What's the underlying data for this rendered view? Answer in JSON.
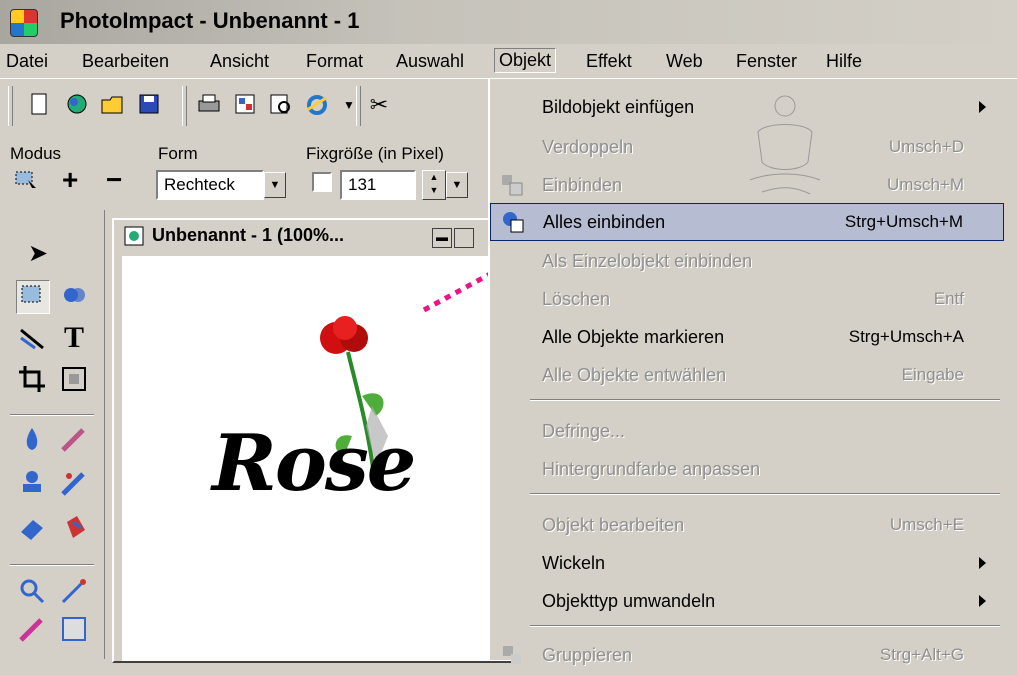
{
  "app": {
    "title": "PhotoImpact - Unbenannt - 1"
  },
  "menubar": {
    "items": [
      "Datei",
      "Bearbeiten",
      "Ansicht",
      "Format",
      "Auswahl",
      "Objekt",
      "Effekt",
      "Web",
      "Fenster",
      "Hilfe"
    ],
    "active": "Objekt"
  },
  "attrbar": {
    "modus_label": "Modus",
    "form_label": "Form",
    "fixsize_label": "Fixgröße (in Pixel)",
    "form_value": "Rechteck",
    "size_value": "131"
  },
  "document": {
    "title": "Unbenannt - 1 (100%...",
    "canvas_text": "Rose"
  },
  "menu": {
    "items": [
      {
        "label": "Bildobjekt einfügen",
        "shortcut": "",
        "disabled": false,
        "submenu": true
      },
      {
        "label": "Verdoppeln",
        "shortcut": "Umsch+D",
        "disabled": true,
        "submenu": false
      },
      {
        "label": "Einbinden",
        "shortcut": "Umsch+M",
        "disabled": true,
        "submenu": false
      },
      {
        "label": "Alles einbinden",
        "shortcut": "Strg+Umsch+M",
        "disabled": false,
        "submenu": false,
        "highlighted": true
      },
      {
        "label": "Als Einzelobjekt einbinden",
        "shortcut": "",
        "disabled": true,
        "submenu": false
      },
      {
        "label": "Löschen",
        "shortcut": "Entf",
        "disabled": true,
        "submenu": false
      },
      {
        "label": "Alle Objekte markieren",
        "shortcut": "Strg+Umsch+A",
        "disabled": false,
        "submenu": false
      },
      {
        "label": "Alle Objekte entwählen",
        "shortcut": "Eingabe",
        "disabled": true,
        "submenu": false
      },
      {
        "label": "Defringe...",
        "shortcut": "",
        "disabled": true,
        "submenu": false
      },
      {
        "label": "Hintergrundfarbe anpassen",
        "shortcut": "",
        "disabled": true,
        "submenu": false
      },
      {
        "label": "Objekt bearbeiten",
        "shortcut": "Umsch+E",
        "disabled": true,
        "submenu": false
      },
      {
        "label": "Wickeln",
        "shortcut": "",
        "disabled": false,
        "submenu": true
      },
      {
        "label": "Objekttyp umwandeln",
        "shortcut": "",
        "disabled": false,
        "submenu": true
      },
      {
        "label": "Gruppieren",
        "shortcut": "Strg+Alt+G",
        "disabled": true,
        "submenu": false
      }
    ]
  },
  "colors": {
    "highlight": "#b6bdd2",
    "highlight_border": "#0a246a",
    "annotation_arrow": "#ee1188",
    "rose": "#d01010"
  }
}
